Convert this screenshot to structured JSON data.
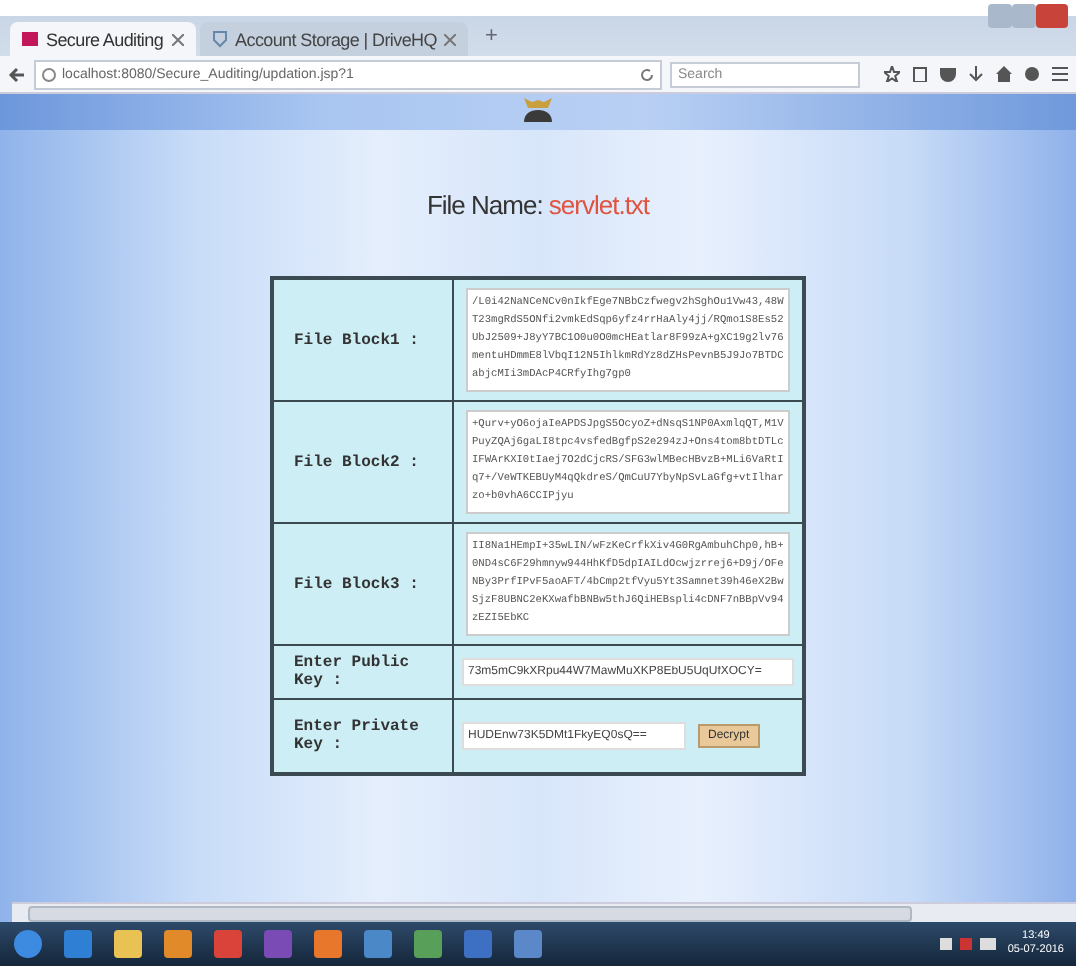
{
  "browser": {
    "tabs": [
      {
        "title": "Secure Auditing",
        "selected": true
      },
      {
        "title": "Account Storage | DriveHQ",
        "selected": false
      }
    ],
    "new_tab": "+",
    "url": "localhost:8080/Secure_Auditing/updation.jsp?1",
    "search": {
      "placeholder": "Search"
    }
  },
  "page": {
    "file_label": "File Name:",
    "file_name": "servlet.txt",
    "blocks": [
      {
        "label": "File Block1 :",
        "content": "/L0i42NaNCeNCv0nIkfEge7NBbCzfwegv2hSghOu1Vw43,48WT23mgRdS5ONfi2vmkEdSqp6yfz4rrHaAly4jj/RQmo1S8Es52UbJ2509+J8yY7BC1O0u0O0mcHEatlar8F99zA+gXC19g2lv76mentuHDmmE8lVbqI12N5IhlkmRdYz8dZHsPevnB5J9Jo7BTDCabjcMIi3mDAcP4CRfyIhg7gp0"
      },
      {
        "label": "File Block2 :",
        "content": "+Qurv+yO6ojaIeAPDSJpgS5OcyoZ+dNsqS1NP0AxmlqQT,M1VPuyZQAj6gaLI8tpc4vsfedBgfpS2e294zJ+Ons4tom8btDTLcIFWArKXI0tIaej7O2dCjcRS/SFG3wlMBecHBvzB+MLi6VaRtIq7+/VeWTKEBUyM4qQkdreS/QmCuU7YbyNpSvLaGfg+vtIlharzo+b0vhA6CCIPjyu"
      },
      {
        "label": "File Block3 :",
        "content": "II8Na1HEmpI+35wLIN/wFzKeCrfkXiv4G0RgAmbuhChp0,hB+0ND4sC6F29hmnyw944HhKfD5dpIAILdOcwjzrrej6+D9j/OFeNBy3PrfIPvF5aoAFT/4bCmp2tfVyu5Yt3Samnet39h46eX2BwSjzF8UBNC2eKXwafbBNBw5thJ6QiHEBspli4cDNF7nBBpVv94zEZI5EbKC"
      }
    ],
    "public_key": {
      "label": "Enter Public Key :",
      "value": "73m5mC9kXRpu44W7MawMuXKP8EbU5UqUfXOCY="
    },
    "private_key": {
      "label": "Enter Private Key :",
      "value": "HUDEnw73K5DMt1FkyEQ0sQ=="
    },
    "decrypt_button": "Decrypt"
  },
  "taskbar": {
    "time": "13:49",
    "date": "05-07-2016"
  }
}
